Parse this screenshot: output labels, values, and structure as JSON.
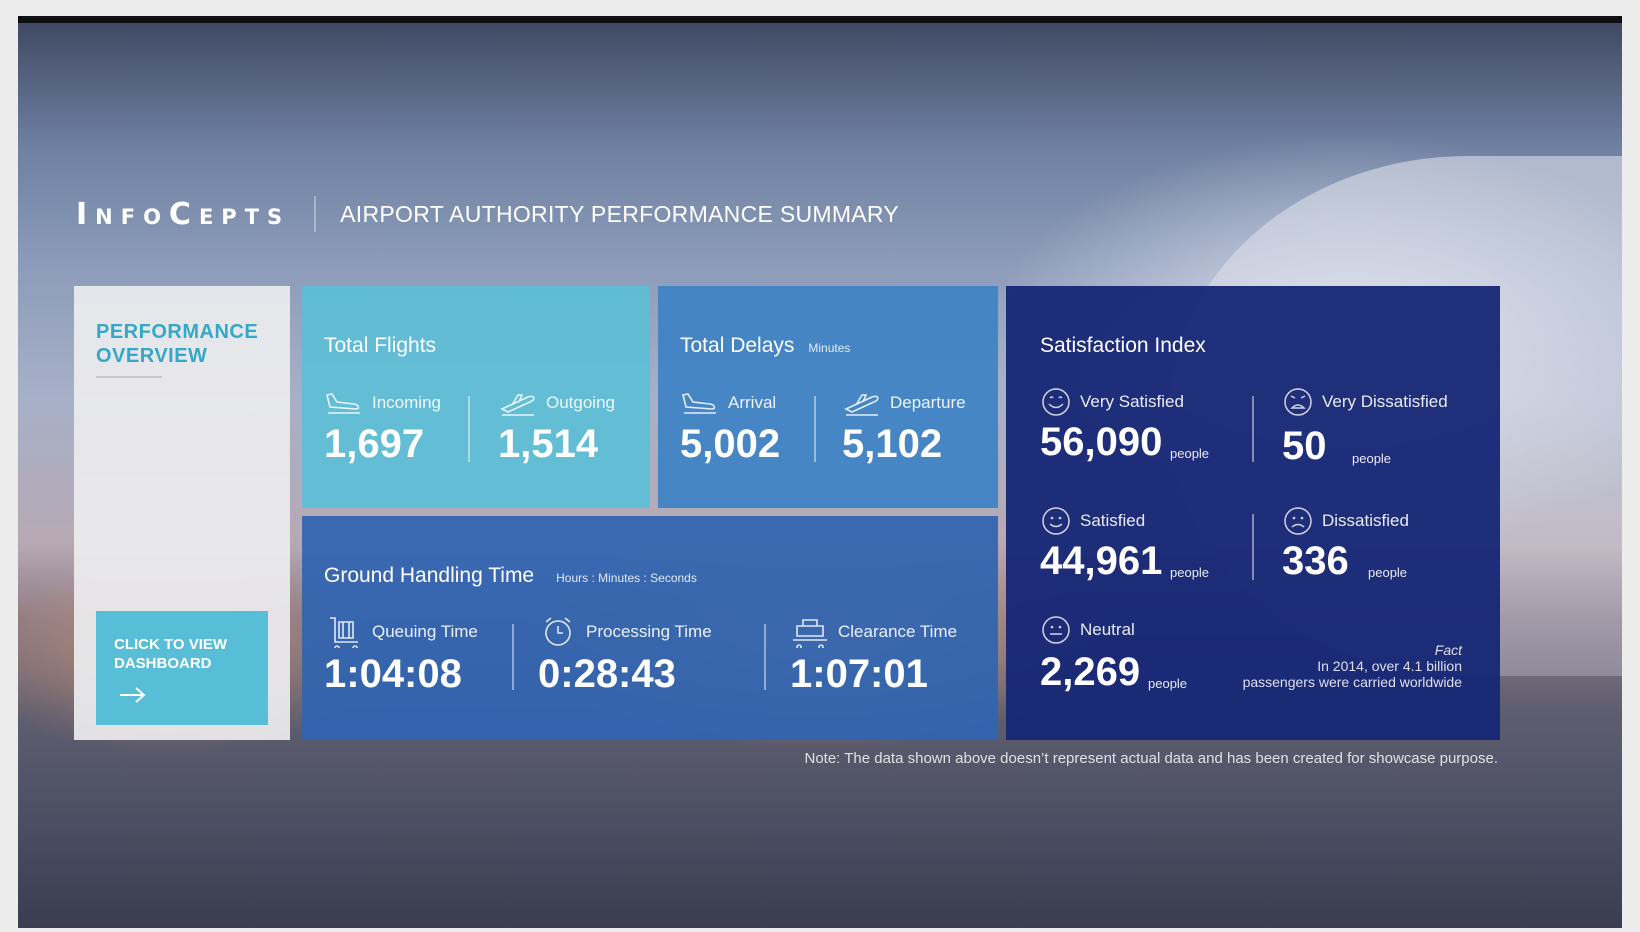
{
  "header": {
    "logo": "InfoCepts",
    "title": "AIRPORT AUTHORITY PERFORMANCE SUMMARY"
  },
  "overview": {
    "title": "PERFORMANCE OVERVIEW",
    "button_label": "CLICK TO VIEW DASHBOARD",
    "button_icon": "arrow-right-icon"
  },
  "flights": {
    "title": "Total Flights",
    "incoming_label": "Incoming",
    "incoming_value": "1,697",
    "outgoing_label": "Outgoing",
    "outgoing_value": "1,514"
  },
  "delays": {
    "title": "Total Delays",
    "subtitle": "Minutes",
    "arrival_label": "Arrival",
    "arrival_value": "5,002",
    "departure_label": "Departure",
    "departure_value": "5,102"
  },
  "ground": {
    "title": "Ground Handling Time",
    "subtitle": "Hours : Minutes : Seconds",
    "queuing_label": "Queuing Time",
    "queuing_value": "1:04:08",
    "processing_label": "Processing Time",
    "processing_value": "0:28:43",
    "clearance_label": "Clearance Time",
    "clearance_value": "1:07:01"
  },
  "satisfaction": {
    "title": "Satisfaction Index",
    "unit": "people",
    "very_satisfied_label": "Very Satisfied",
    "very_satisfied_value": "56,090",
    "very_dissatisfied_label": "Very Dissatisfied",
    "very_dissatisfied_value": "50",
    "satisfied_label": "Satisfied",
    "satisfied_value": "44,961",
    "dissatisfied_label": "Dissatisfied",
    "dissatisfied_value": "336",
    "neutral_label": "Neutral",
    "neutral_value": "2,269",
    "fact_title": "Fact",
    "fact_line1": "In 2014, over 4.1 billion",
    "fact_line2": "passengers were carried worldwide"
  },
  "note": "Note: The data shown above doesn’t represent actual data and has been created for showcase purpose.",
  "colors": {
    "accent_teal": "#58bdd6",
    "flights_tile": "#5cbed6",
    "delays_tile": "#3e82c4",
    "ground_tile": "#3064b0",
    "satisfaction_tile": "#182876"
  }
}
